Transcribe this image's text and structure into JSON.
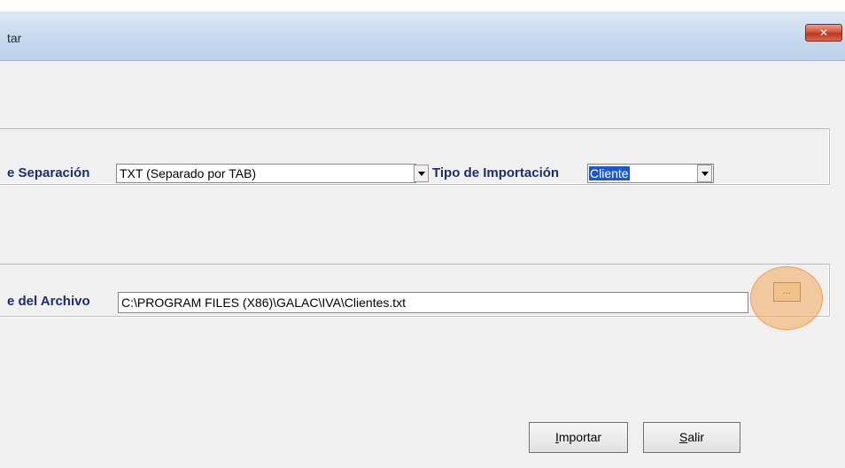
{
  "window": {
    "title": "tar"
  },
  "format_row": {
    "separator_label": "e Separación",
    "separator_value": "TXT (Separado por TAB)",
    "import_type_label": "Tipo de Importación",
    "import_type_value": "Cliente"
  },
  "file_row": {
    "file_label": "e del Archivo",
    "file_path": "C:\\PROGRAM FILES (X86)\\GALAC\\IVA\\Clientes.txt",
    "browse_label": "..."
  },
  "buttons": {
    "import_accel": "I",
    "import_rest": "mportar",
    "exit_accel": "S",
    "exit_rest": "alir"
  },
  "colors": {
    "label_text": "#1d2f6b",
    "selection": "#1e56cc",
    "highlight": "#f3993c"
  }
}
